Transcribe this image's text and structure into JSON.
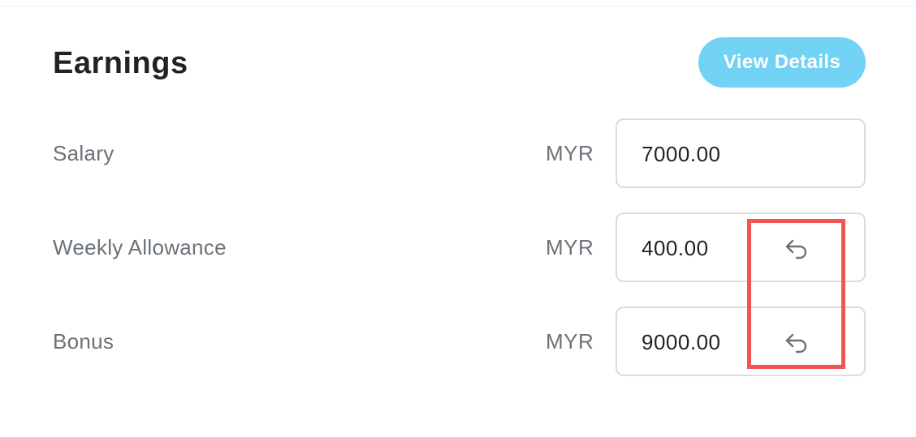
{
  "section": {
    "title": "Earnings",
    "view_details_label": "View Details"
  },
  "rows": [
    {
      "label": "Salary",
      "currency": "MYR",
      "value": "7000.00",
      "has_undo": false
    },
    {
      "label": "Weekly Allowance",
      "currency": "MYR",
      "value": "400.00",
      "has_undo": true,
      "undo_icon": "undo-icon"
    },
    {
      "label": "Bonus",
      "currency": "MYR",
      "value": "9000.00",
      "has_undo": true,
      "undo_icon": "undo-icon"
    }
  ],
  "colors": {
    "accent_button": "#72d2f4",
    "highlight": "#f25353",
    "label_text": "#6b7278",
    "title_text": "#1f2326",
    "input_border": "#d8dde0"
  }
}
